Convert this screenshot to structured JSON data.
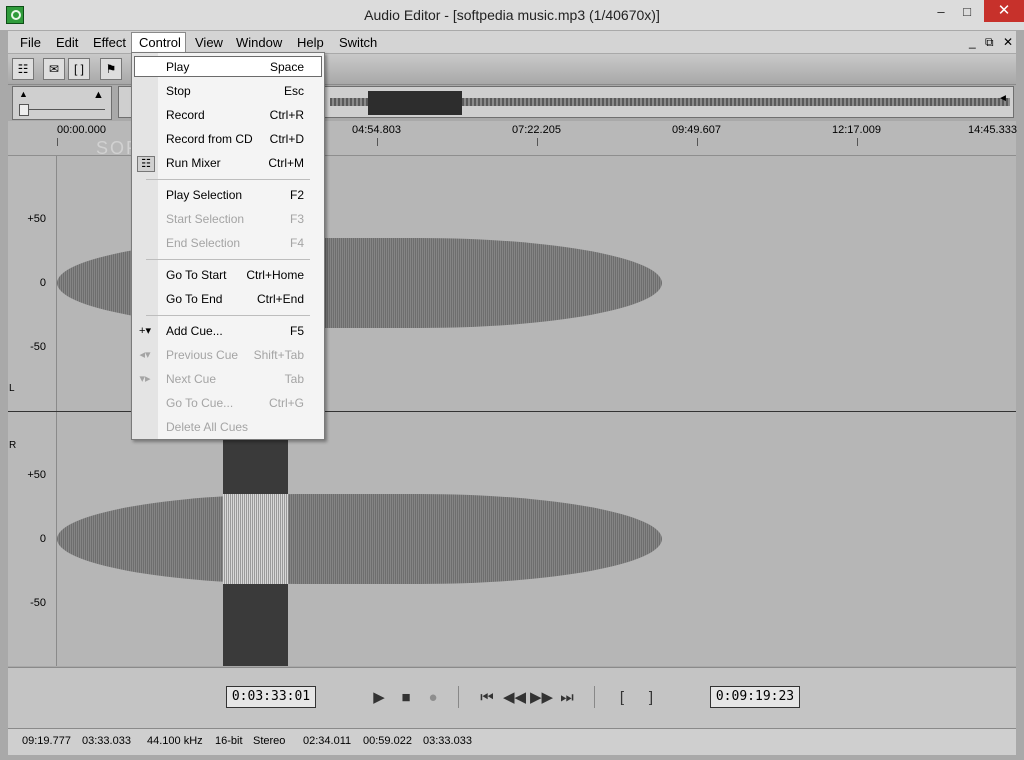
{
  "window": {
    "title": "Audio Editor - [softpedia music.mp3 (1/40670x)]",
    "minimize": "–",
    "maximize": "□",
    "close": "✕",
    "mdi_minimize": "_",
    "mdi_restore": "⧉",
    "mdi_close": "✕"
  },
  "menubar": {
    "items": [
      {
        "label": "File"
      },
      {
        "label": "Edit"
      },
      {
        "label": "Effect"
      },
      {
        "label": "Control"
      },
      {
        "label": "View"
      },
      {
        "label": "Window"
      },
      {
        "label": "Help"
      },
      {
        "label": "Switch"
      }
    ]
  },
  "control_menu": {
    "items": [
      {
        "label": "Play",
        "shortcut": "Space"
      },
      {
        "label": "Stop",
        "shortcut": "Esc"
      },
      {
        "label": "Record",
        "shortcut": "Ctrl+R"
      },
      {
        "label": "Record from CD",
        "shortcut": "Ctrl+D"
      },
      {
        "label": "Run Mixer",
        "shortcut": "Ctrl+M"
      },
      {
        "label": "Play Selection",
        "shortcut": "F2"
      },
      {
        "label": "Start Selection",
        "shortcut": "F3"
      },
      {
        "label": "End Selection",
        "shortcut": "F4"
      },
      {
        "label": "Go To Start",
        "shortcut": "Ctrl+Home"
      },
      {
        "label": "Go To End",
        "shortcut": "Ctrl+End"
      },
      {
        "label": "Add Cue...",
        "shortcut": "F5"
      },
      {
        "label": "Previous Cue",
        "shortcut": "Shift+Tab"
      },
      {
        "label": "Next Cue",
        "shortcut": "Tab"
      },
      {
        "label": "Go To Cue...",
        "shortcut": "Ctrl+G"
      },
      {
        "label": "Delete All Cues",
        "shortcut": ""
      }
    ]
  },
  "ruler": {
    "ticks": [
      "00:00.000",
      "04:54.803",
      "07:22.205",
      "09:49.607",
      "12:17.009",
      "14:45.333"
    ]
  },
  "tracks": {
    "left_label": "L",
    "right_label": "R",
    "y_labels": [
      "+50",
      "0",
      "-50"
    ]
  },
  "transport": {
    "start_time": "0:03:33:01",
    "end_time": "0:09:19:23"
  },
  "status": {
    "fields": [
      "09:19.777",
      "03:33.033",
      "44.100 kHz",
      "16-bit",
      "Stereo",
      "02:34.011",
      "00:59.022",
      "03:33.033"
    ]
  },
  "watermark": "SOFTPEDIA"
}
